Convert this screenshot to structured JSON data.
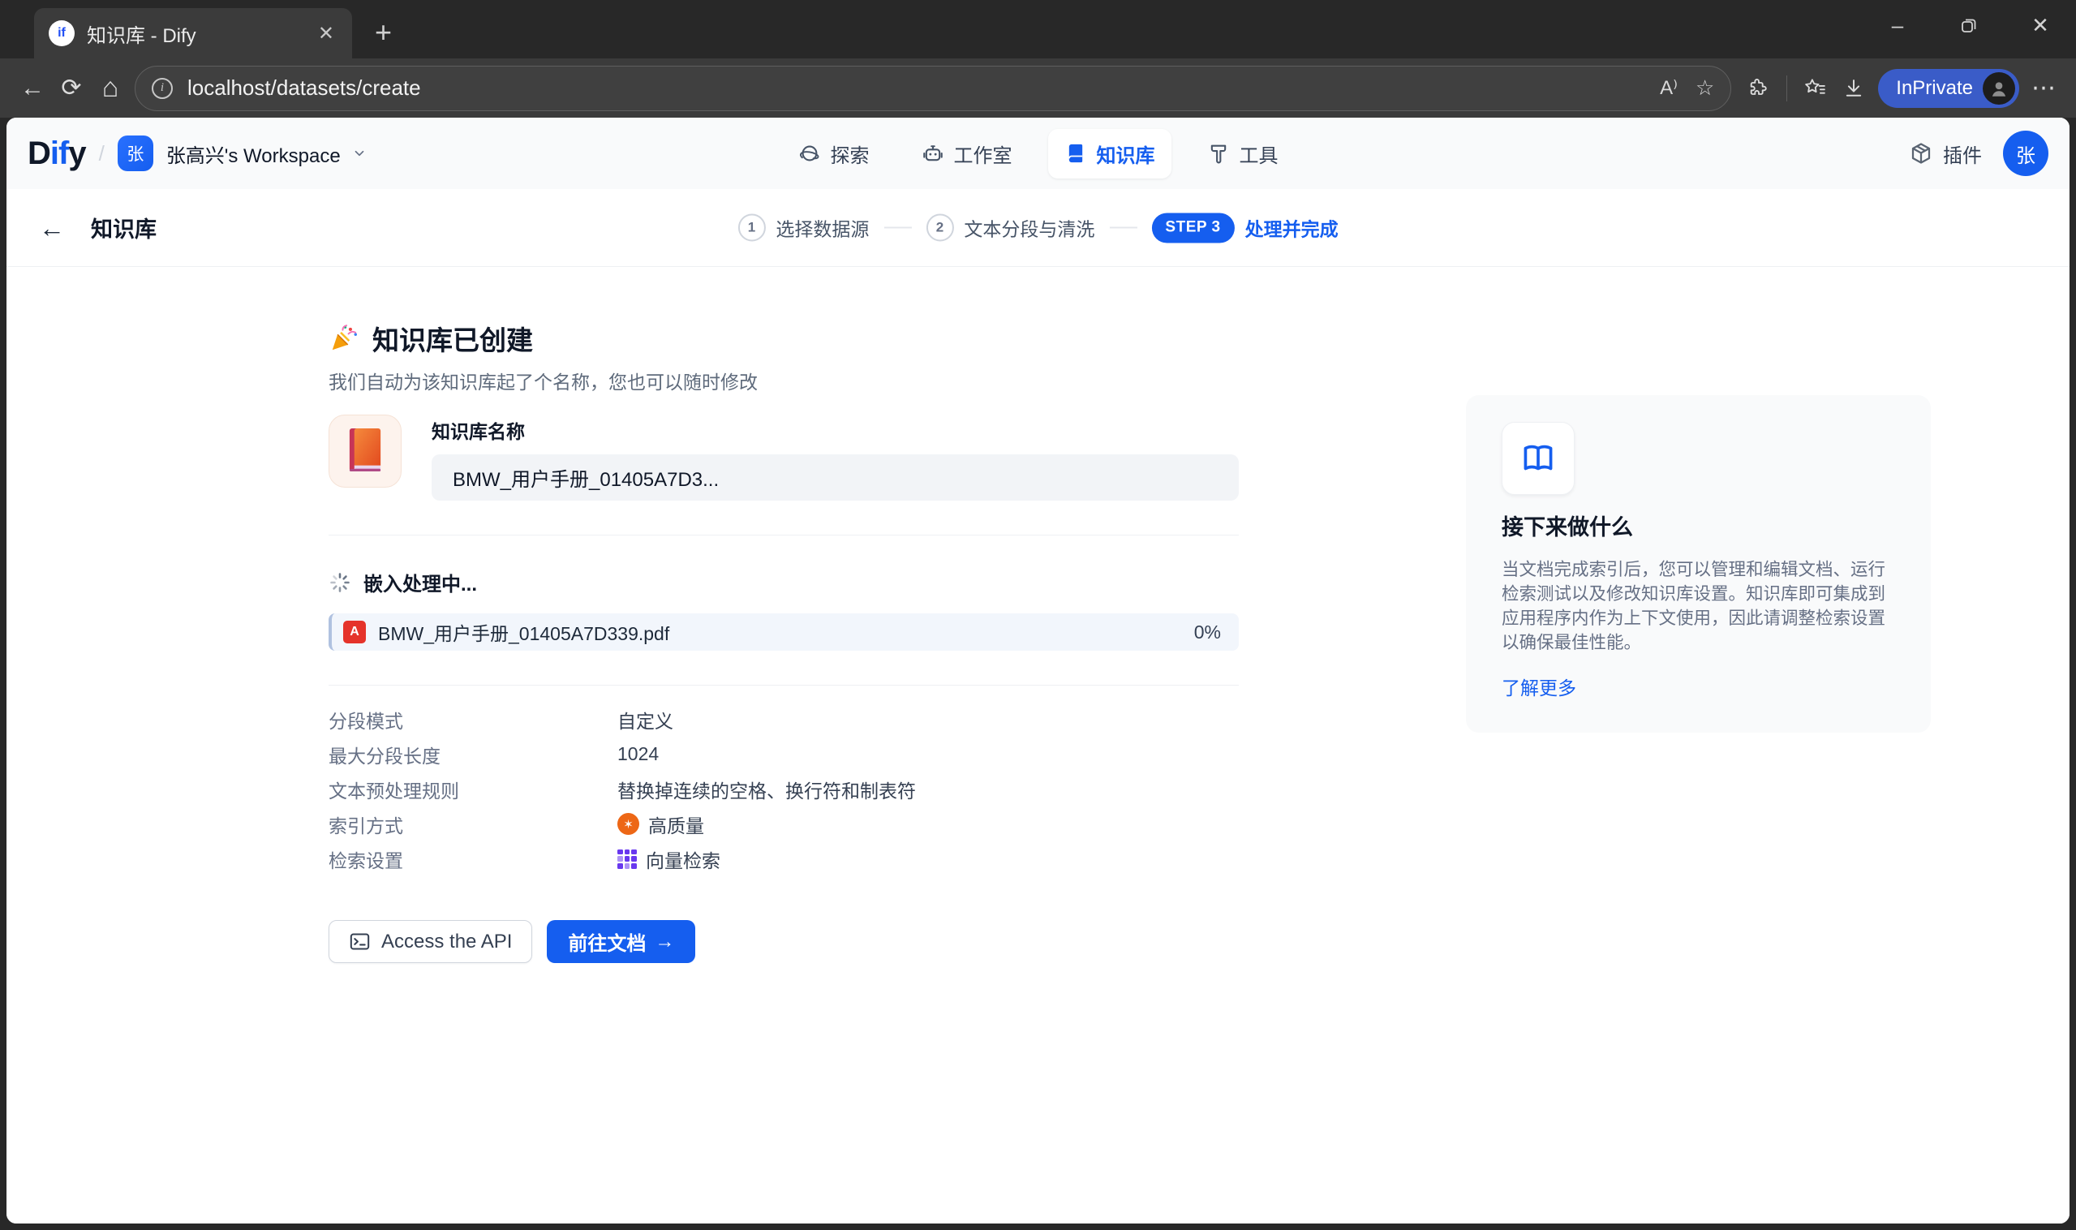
{
  "browser": {
    "tab": {
      "title": "知识库 - Dify",
      "favicon_text": "if"
    },
    "url": "localhost/datasets/create",
    "inprivate_label": "InPrivate"
  },
  "icons": {
    "back": "←",
    "refresh": "⟳",
    "home": "⌂",
    "info": "i",
    "read_aloud": "A⁾",
    "star": "☆",
    "dots": "⋯",
    "minimize": "–",
    "close": "✕",
    "new_tab": "+",
    "arrow_right": "→",
    "star6": "✶",
    "pdf_letter": "A"
  },
  "header": {
    "logo": {
      "d": "D",
      "if": "if",
      "y": "y"
    },
    "workspace": {
      "initial": "张",
      "name": "张高兴's Workspace"
    },
    "nav": [
      {
        "label": "探索"
      },
      {
        "label": "工作室"
      },
      {
        "label": "知识库"
      },
      {
        "label": "工具"
      }
    ],
    "plugins_label": "插件",
    "avatar_initial": "张"
  },
  "subheader": {
    "back_title": "知识库",
    "steps": [
      {
        "num": "1",
        "label": "选择数据源"
      },
      {
        "num": "2",
        "label": "文本分段与清洗"
      },
      {
        "num": "STEP 3",
        "label": "处理并完成"
      }
    ]
  },
  "main": {
    "title": "知识库已创建",
    "subtitle": "我们自动为该知识库起了个名称，您也可以随时修改",
    "name_label": "知识库名称",
    "name_value": "BMW_用户手册_01405A7D3...",
    "processing": {
      "title": "嵌入处理中...",
      "file_name": "BMW_用户手册_01405A7D339.pdf",
      "percent": "0%"
    },
    "settings": [
      {
        "label": "分段模式",
        "value": "自定义"
      },
      {
        "label": "最大分段长度",
        "value": "1024"
      },
      {
        "label": "文本预处理规则",
        "value": "替换掉连续的空格、换行符和制表符"
      },
      {
        "label": "索引方式",
        "value": "高质量"
      },
      {
        "label": "检索设置",
        "value": "向量检索"
      }
    ],
    "buttons": {
      "api": "Access the API",
      "docs": "前往文档"
    }
  },
  "aside": {
    "title": "接下来做什么",
    "body": "当文档完成索引后，您可以管理和编辑文档、运行检索测试以及修改知识库设置。知识库即可集成到应用程序内作为上下文使用，因此请调整检索设置以确保最佳性能。",
    "link": "了解更多"
  },
  "colors": {
    "primary": "#155eef",
    "pdf_red": "#e5332a",
    "orange": "#ed6716",
    "purple": "#6938ef"
  }
}
